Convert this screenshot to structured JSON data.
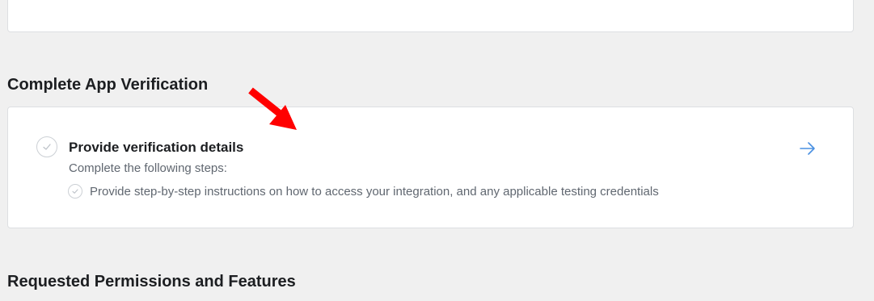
{
  "sections": {
    "verification": {
      "title": "Complete App Verification",
      "task": {
        "title": "Provide verification details",
        "subtitle": "Complete the following steps:",
        "steps": [
          {
            "label": "Provide step-by-step instructions on how to access your integration, and any applicable testing credentials"
          }
        ],
        "action_icon": "arrow-right-icon"
      }
    },
    "permissions": {
      "title": "Requested Permissions and Features"
    }
  },
  "colors": {
    "background": "#f0f0f0",
    "card": "#ffffff",
    "border": "#dddfe2",
    "text_primary": "#1c1e21",
    "text_secondary": "#606770",
    "accent": "#4a90e2",
    "annotation": "#ff0000"
  }
}
